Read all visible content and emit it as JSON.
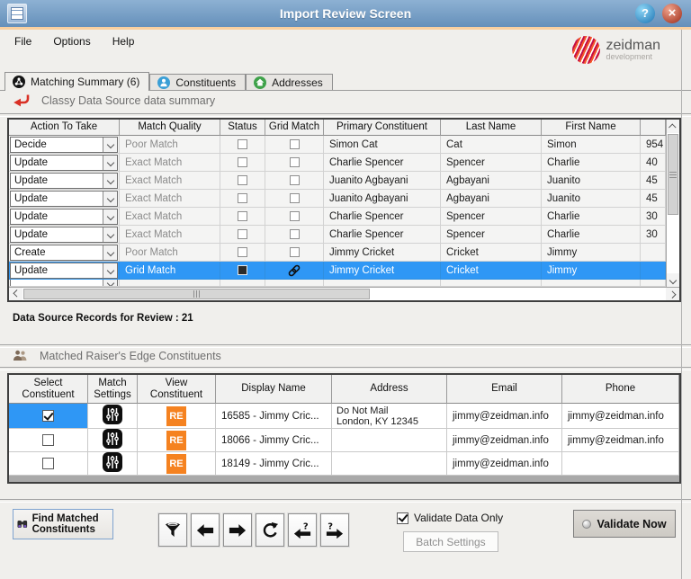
{
  "window": {
    "title": "Import Review Screen",
    "menu_items": [
      "File",
      "Options",
      "Help"
    ],
    "logo_title": "zeidman",
    "logo_subtitle": "development",
    "help_glyph": "?",
    "close_glyph": "×"
  },
  "tabs": {
    "matching": "Matching Summary (6)",
    "constituents": "Constituents",
    "addresses": "Addresses"
  },
  "source_summary": {
    "title": "Classy Data Source data summary",
    "records_label": "Data Source Records for Review : 21",
    "columns": [
      "Action To Take",
      "Match Quality",
      "Status",
      "Grid Match",
      "Primary Constituent",
      "Last Name",
      "First Name",
      ""
    ],
    "rows": [
      {
        "action": "Decide",
        "quality": "Poor Match",
        "status_checked": false,
        "link": false,
        "primary": "Simon Cat",
        "last_name": "Cat",
        "first_name": "Simon",
        "num": "954",
        "selected": false
      },
      {
        "action": "Update",
        "quality": "Exact Match",
        "status_checked": false,
        "link": false,
        "primary": "Charlie Spencer",
        "last_name": "Spencer",
        "first_name": "Charlie",
        "num": "40",
        "selected": false
      },
      {
        "action": "Update",
        "quality": "Exact Match",
        "status_checked": false,
        "link": false,
        "primary": "Juanito Agbayani",
        "last_name": "Agbayani",
        "first_name": "Juanito",
        "num": "45",
        "selected": false
      },
      {
        "action": "Update",
        "quality": "Exact Match",
        "status_checked": false,
        "link": false,
        "primary": "Juanito Agbayani",
        "last_name": "Agbayani",
        "first_name": "Juanito",
        "num": "45",
        "selected": false
      },
      {
        "action": "Update",
        "quality": "Exact Match",
        "status_checked": false,
        "link": false,
        "primary": "Charlie Spencer",
        "last_name": "Spencer",
        "first_name": "Charlie",
        "num": "30",
        "selected": false
      },
      {
        "action": "Update",
        "quality": "Exact Match",
        "status_checked": false,
        "link": false,
        "primary": "Charlie Spencer",
        "last_name": "Spencer",
        "first_name": "Charlie",
        "num": "30",
        "selected": false
      },
      {
        "action": "Create",
        "quality": "Poor Match",
        "status_checked": false,
        "link": false,
        "primary": "Jimmy Cricket",
        "last_name": "Cricket",
        "first_name": "Jimmy",
        "num": "",
        "selected": false
      },
      {
        "action": "Update",
        "quality": "Grid Match",
        "status_checked": true,
        "link": true,
        "primary": "Jimmy Cricket",
        "last_name": "Cricket",
        "first_name": "Jimmy",
        "num": "",
        "selected": true
      }
    ]
  },
  "matched_constituents": {
    "title": "Matched Raiser's Edge Constituents",
    "columns": [
      "Select Constituent",
      "Match Settings",
      "View Constituent",
      "Display Name",
      "Address",
      "Email",
      "Phone"
    ],
    "re_badge": "RE",
    "rows": [
      {
        "selected": true,
        "display_name": "16585 - Jimmy Cric...",
        "address_line1": "Do Not Mail",
        "address_line2": "London, KY  12345",
        "email": "jimmy@zeidman.info",
        "phone": "jimmy@zeidman.info"
      },
      {
        "selected": false,
        "display_name": "18066 - Jimmy Cric...",
        "address_line1": "",
        "address_line2": "",
        "email": "jimmy@zeidman.info",
        "phone": "jimmy@zeidman.info"
      },
      {
        "selected": false,
        "display_name": "18149 - Jimmy Cric...",
        "address_line1": "",
        "address_line2": "",
        "email": "jimmy@zeidman.info",
        "phone": ""
      }
    ]
  },
  "footer": {
    "find_matched_label": "Find Matched Constituents",
    "validate_data_only_label": "Validate Data Only",
    "validate_checked": true,
    "batch_settings_label": "Batch Settings",
    "validate_now_label": "Validate Now"
  },
  "colors": {
    "titlebar_top": "#8db1d3",
    "titlebar_bottom": "#6590ba",
    "accent_orange": "#f9d0a0",
    "selected_row_blue": "#2f97f5",
    "re_orange": "#f58220",
    "arrow_red": "#d93025",
    "tab_icon_blue": "#3b9fd6",
    "tab_icon_green": "#3fa24a"
  }
}
